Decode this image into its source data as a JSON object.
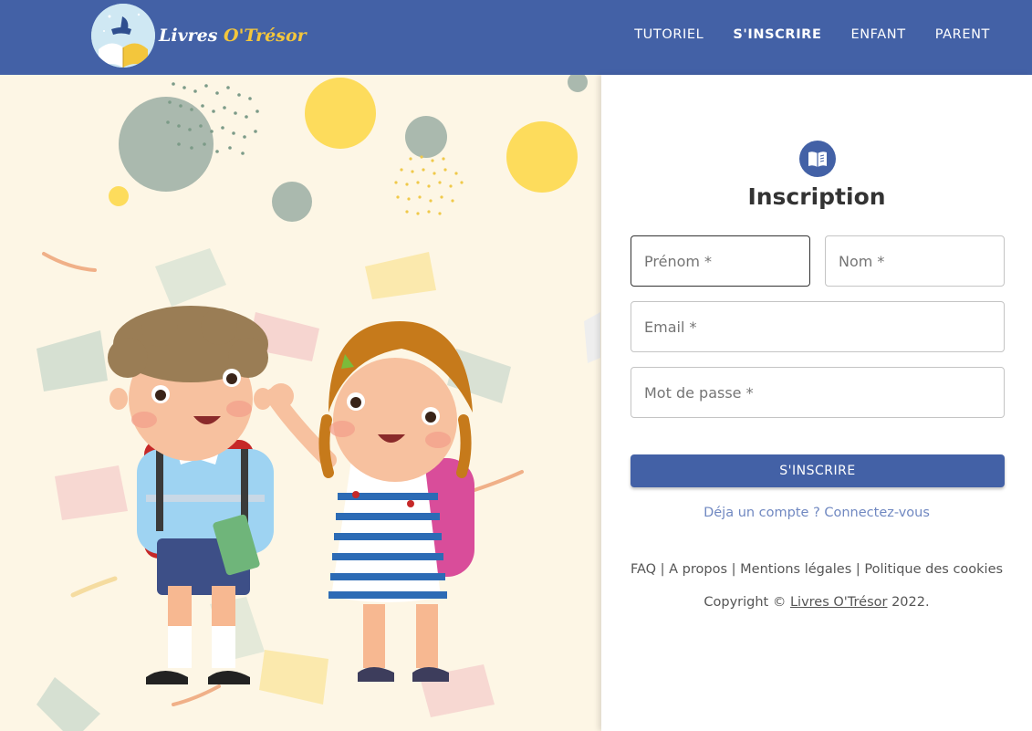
{
  "header": {
    "brand": {
      "part1": "Livres ",
      "part2": "O'Trésor"
    },
    "nav": [
      {
        "label": "TUTORIEL",
        "active": false
      },
      {
        "label": "S'INSCRIRE",
        "active": true
      },
      {
        "label": "ENFANT",
        "active": false
      },
      {
        "label": "PARENT",
        "active": false
      }
    ]
  },
  "form": {
    "icon": "book-open-icon",
    "title": "Inscription",
    "fields": {
      "firstname": "Prénom *",
      "lastname": "Nom *",
      "email": "Email *",
      "password": "Mot de passe *"
    },
    "submit_label": "S'INSCRIRE",
    "login_link": "Déja un compte ? Connectez-vous"
  },
  "footer": {
    "links": [
      "FAQ",
      "A propos",
      "Mentions légales",
      "Politique des cookies"
    ],
    "separator": " | ",
    "copyright_prefix": "Copyright © ",
    "copyright_brand": "Livres O'Trésor",
    "copyright_suffix": " 2022."
  },
  "colors": {
    "primary": "#4361a6",
    "accent": "#f3c63c",
    "link": "#7088c1",
    "hero_bg": "#fdf6e5"
  }
}
